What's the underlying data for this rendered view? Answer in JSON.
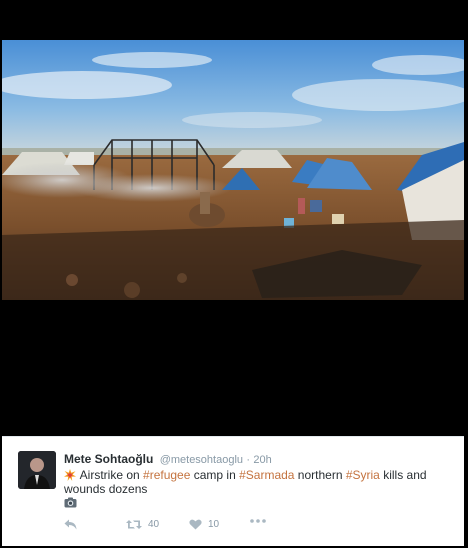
{
  "tweet": {
    "author_name": "Mete Sohtaoğlu",
    "author_handle": "@metesohtaoglu",
    "separator": "·",
    "timestamp": "20h",
    "text": {
      "part1": " Airstrike on ",
      "hashtag1": "#refugee",
      "part2": " camp in ",
      "hashtag2": "#Sarmada",
      "part3": " northern ",
      "hashtag3": "#Syria",
      "part4": " kills and wounds dozens"
    },
    "emoji_icon": "collision-icon",
    "media_icon": "camera-icon",
    "retweet_count": "40",
    "like_count": "10"
  },
  "media": {
    "description_icon": "refugee-camp-photo"
  },
  "colors": {
    "hashtag": "#c4733f",
    "meta_gray": "#8899a6",
    "text": "#292f33"
  }
}
